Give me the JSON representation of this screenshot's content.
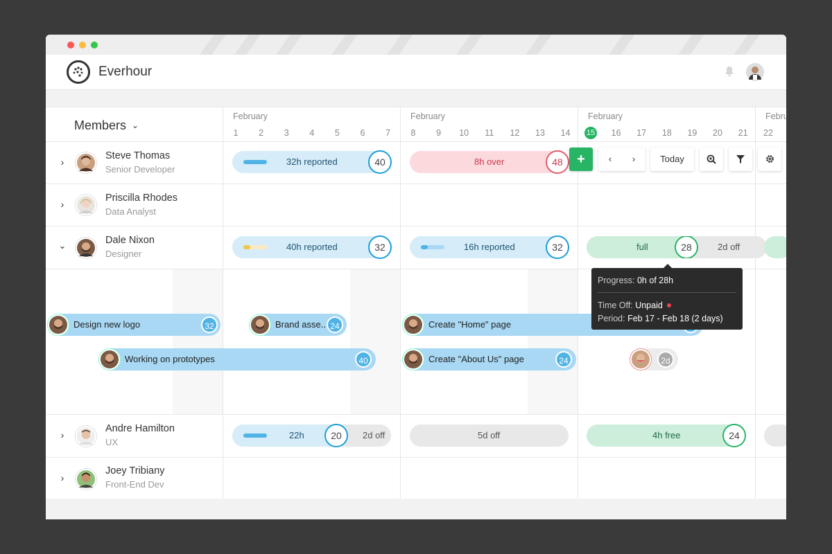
{
  "app": {
    "name": "Everhour"
  },
  "colors": {
    "accent_blue": "#1a9ed6",
    "over_red": "#e05a6a",
    "free_green": "#27b464",
    "task_blue": "#a8d8f3"
  },
  "icons": {
    "logo": "everhour-logo-icon",
    "bell": "bell-icon",
    "add": "plus-icon",
    "prev": "chevron-left-icon",
    "next": "chevron-right-icon",
    "zoom": "zoom-icon",
    "filter": "filter-icon",
    "settings": "gear-icon"
  },
  "header": {
    "members_label": "Members"
  },
  "weeks": [
    {
      "month": "February",
      "days": [
        "1",
        "2",
        "3",
        "4",
        "5",
        "6",
        "7"
      ]
    },
    {
      "month": "February",
      "days": [
        "8",
        "9",
        "10",
        "11",
        "12",
        "13",
        "14"
      ]
    },
    {
      "month": "February",
      "days": [
        "15",
        "16",
        "17",
        "18",
        "19",
        "20",
        "21"
      ],
      "today": "15"
    },
    {
      "month": "Febru",
      "days": [
        "22"
      ]
    }
  ],
  "toolbar": {
    "today_label": "Today",
    "add": "+"
  },
  "members": [
    {
      "name": "Steve Thomas",
      "role": "Senior Developer",
      "w1": {
        "label": "32h reported",
        "capacity": "40",
        "progress": 0.35
      },
      "w2": {
        "label": "8h over",
        "capacity": "48"
      }
    },
    {
      "name": "Priscilla Rhodes",
      "role": "Data Analyst"
    },
    {
      "name": "Dale Nixon",
      "role": "Designer",
      "w1": {
        "label": "40h reported",
        "capacity": "32",
        "progress": 0.2
      },
      "w2": {
        "label": "16h reported",
        "capacity": "32",
        "progress": 0.25
      },
      "w3": {
        "label": "full",
        "capacity": "28",
        "off": "2d off"
      },
      "tasks": [
        {
          "label": "Design new logo",
          "hours": "32"
        },
        {
          "label": "Brand asse..",
          "hours": "24"
        },
        {
          "label": "Create \"Home\" page",
          "hours": "32"
        },
        {
          "label": "Working on prototypes",
          "hours": "40"
        },
        {
          "label": "Create \"About Us\" page",
          "hours": "24"
        },
        {
          "label": "",
          "hours": "2d"
        }
      ]
    },
    {
      "name": "Andre Hamilton",
      "role": "UX",
      "w1": {
        "label": "22h",
        "capacity": "20",
        "off": "2d off",
        "progress": 0.6
      },
      "w2": {
        "label": "5d off"
      },
      "w3": {
        "label": "4h free",
        "capacity": "24"
      }
    },
    {
      "name": "Joey Tribiany",
      "role": "Front-End Dev"
    }
  ],
  "tooltip": {
    "progress_label": "Progress:",
    "progress_value": "0h of 28h",
    "timeoff_label": "Time Off:",
    "timeoff_value": "Unpaid",
    "period_label": "Period:",
    "period_value": "Feb 17 - Feb 18",
    "period_days": "(2 days)"
  }
}
